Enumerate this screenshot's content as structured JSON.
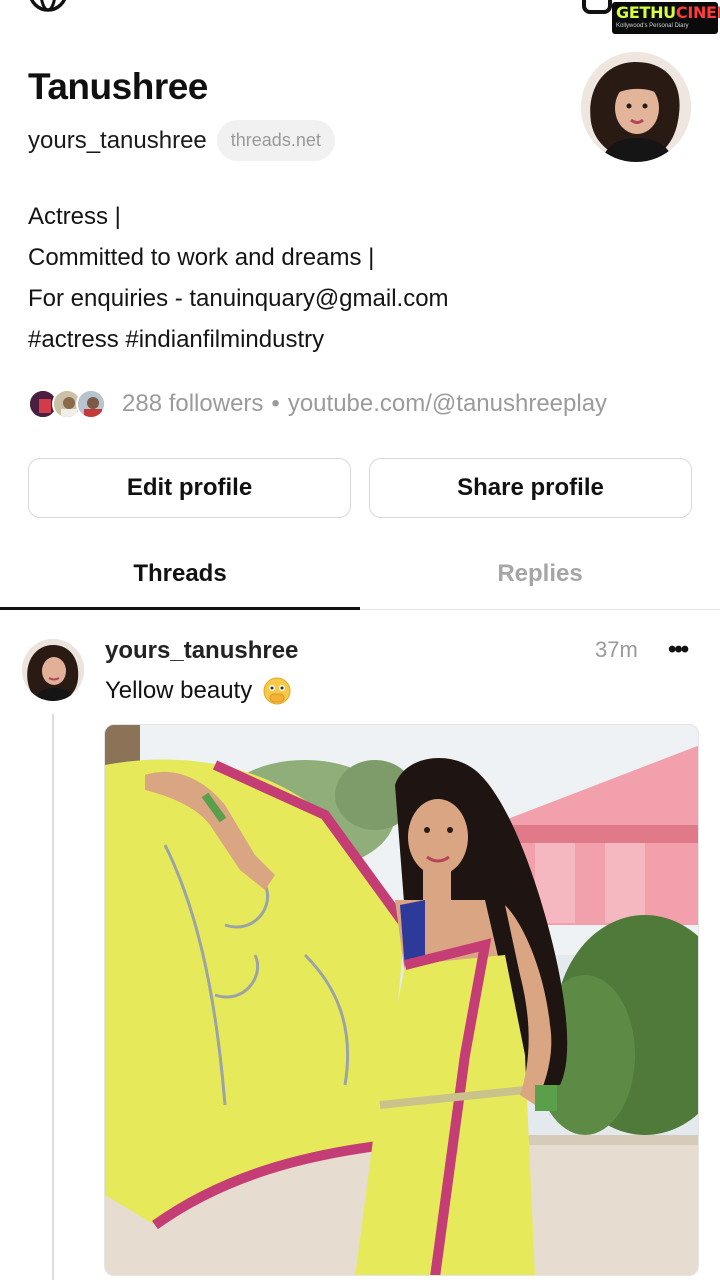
{
  "profile": {
    "name": "Tanushree",
    "handle": "yours_tanushree",
    "domain_pill": "threads.net",
    "bio": [
      "Actress |",
      "Committed to work and dreams |",
      "For enquiries - tanuinquary@gmail.com",
      "#actress #indianfilmindustry"
    ],
    "followers": "288 followers",
    "separator": "•",
    "link": "youtube.com/@tanushreeplay"
  },
  "buttons": {
    "edit": "Edit profile",
    "share": "Share profile"
  },
  "tabs": {
    "threads": "Threads",
    "replies": "Replies",
    "active": "threads"
  },
  "post": {
    "username": "yours_tanushree",
    "time": "37m",
    "more": "•••",
    "text": "Yellow beauty",
    "emoji": "face-with-open-eyes-and-hand-over-mouth"
  },
  "watermark": {
    "brand_left": "GETHU",
    "brand_right": "CINEMA",
    "tagline": "Kollywood's Personal Diary"
  },
  "icons": {
    "globe": "globe-icon",
    "instagram": "instagram-icon"
  },
  "colors": {
    "text": "#101010",
    "muted": "#9b9b9b",
    "border": "#d9d9d9",
    "saree_yellow": "#e6ea5a"
  }
}
